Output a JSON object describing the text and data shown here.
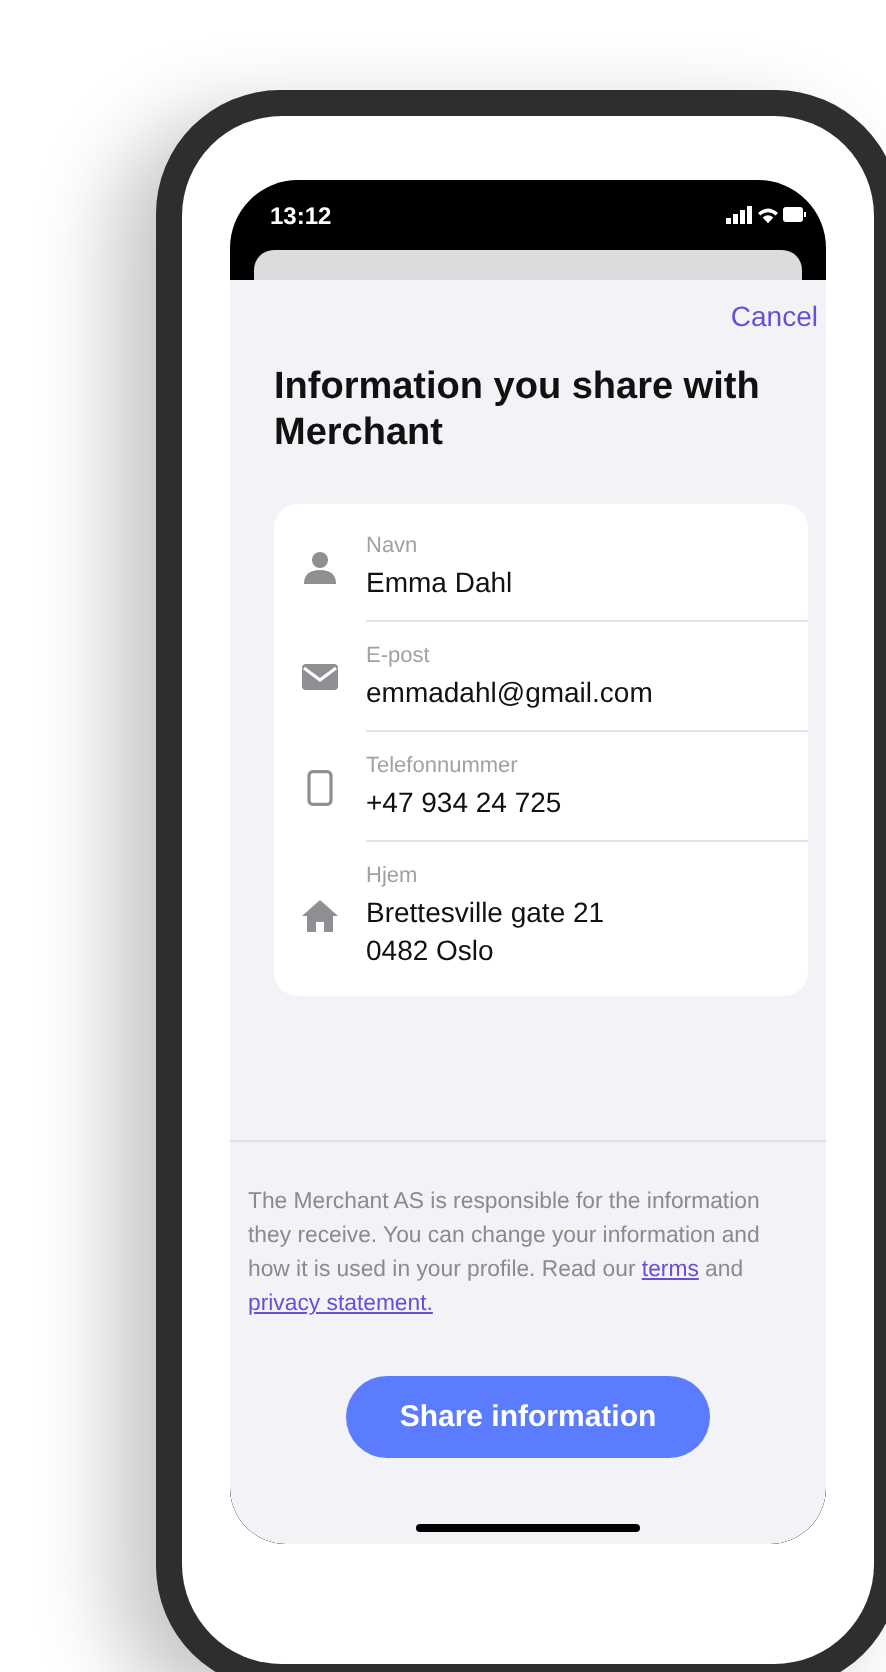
{
  "status_bar": {
    "time": "13:12"
  },
  "sheet": {
    "cancel": "Cancel",
    "title": "Information you share with Merchant",
    "fields": [
      {
        "kind": "person",
        "label": "Navn",
        "value": "Emma Dahl"
      },
      {
        "kind": "email",
        "label": "E-post",
        "value": "emmadahl@gmail.com"
      },
      {
        "kind": "phone",
        "label": "Telefonnummer",
        "value": "+47 934 24 725"
      },
      {
        "kind": "home",
        "label": "Hjem",
        "value": "Brettesville gate 21\n0482 Oslo"
      }
    ],
    "disclaimer": [
      {
        "kind": "text",
        "text": "The Merchant AS is responsible for the information they receive. You can change your information and how it is used in your profile. Read our "
      },
      {
        "kind": "link",
        "text": "terms"
      },
      {
        "kind": "text",
        "text": " and "
      },
      {
        "kind": "link",
        "text": "privacy statement."
      }
    ],
    "button": "Share information"
  }
}
